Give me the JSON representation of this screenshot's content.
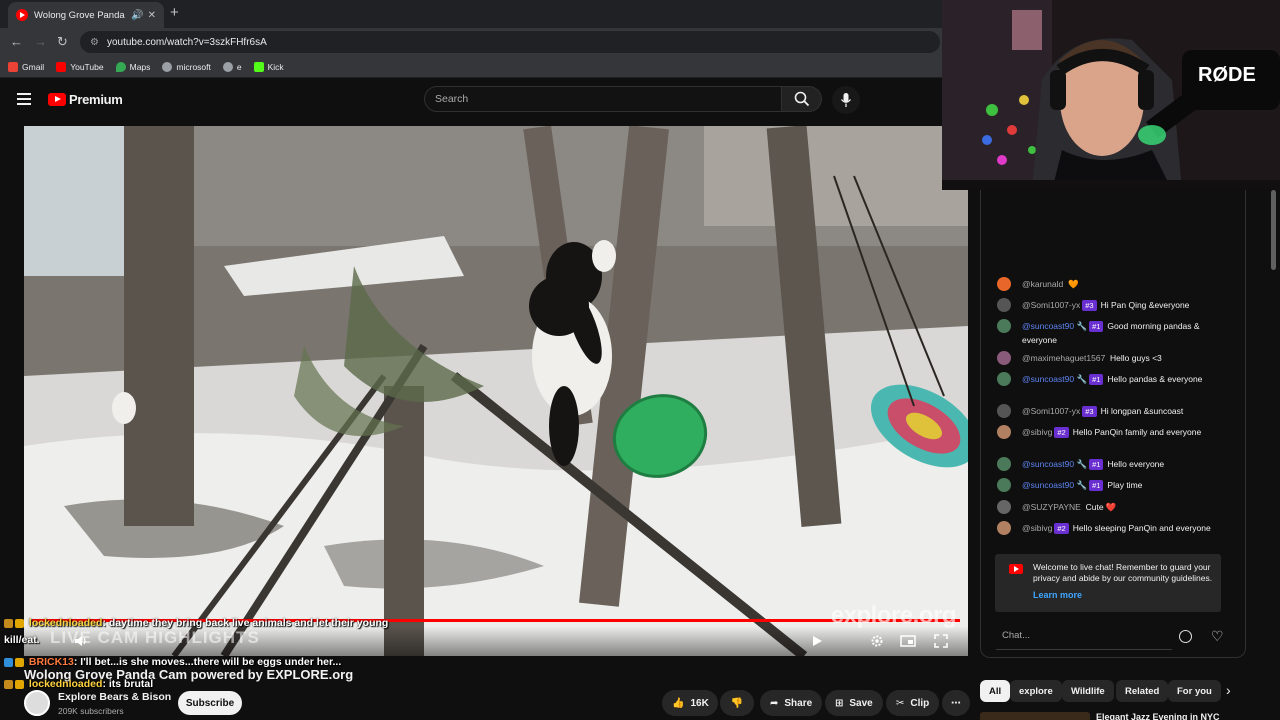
{
  "browser": {
    "tab_title": "Wolong Grove Panda Cam",
    "url": "youtube.com/watch?v=3szkFHfr6sA",
    "bookmarks": [
      "Gmail",
      "YouTube",
      "Maps",
      "microsoft",
      "e",
      "Kick"
    ]
  },
  "header": {
    "logo_text": "Premium",
    "search_placeholder": "Search"
  },
  "video": {
    "watermark": "explore.org",
    "overlay_lines": [
      {
        "user": "lockednloaded",
        "text": ": daytime they bring back live animals and let their young"
      },
      {
        "user": "",
        "text": "kill/eat."
      },
      {
        "user": "BRICK13",
        "text": ": I'll bet...is she moves...there will be eggs under her..."
      },
      {
        "user": "lockednloaded",
        "text": ": its brutal"
      }
    ],
    "overlay_highlights": "LIVE CAM HIGHLIGHTS",
    "title": "Wolong Grove Panda Cam powered by EXPLORE.org"
  },
  "channel": {
    "name": "Explore Bears & Bison",
    "subscribers": "209K subscribers",
    "subscribe_label": "Subscribe"
  },
  "actions": {
    "likes": "16K",
    "share": "Share",
    "save": "Save",
    "clip": "Clip"
  },
  "webcam": {
    "mic_brand": "RØDE"
  },
  "chat": {
    "messages": [
      {
        "author": "@karunald",
        "badge": "",
        "text": "🧡",
        "mod": false,
        "color": "#e8662a"
      },
      {
        "author": "@Somi1007-yx",
        "badge": "#3",
        "text": "Hi Pan Qing &everyone",
        "mod": false,
        "color": "#555"
      },
      {
        "author": "@suncoast90",
        "badge": "#1",
        "text": "Good morning pandas & everyone",
        "mod": true,
        "color": "#4a7a5a"
      },
      {
        "author": "@maximehaguet1567",
        "badge": "",
        "text": "Hello guys <3",
        "mod": false,
        "color": "#8a5a7a"
      },
      {
        "author": "@suncoast90",
        "badge": "#1",
        "text": "Hello pandas & everyone",
        "mod": true,
        "color": "#4a7a5a"
      },
      {
        "author": "@Somi1007-yx",
        "badge": "#3",
        "text": "Hi longpan &suncoast",
        "mod": false,
        "color": "#555"
      },
      {
        "author": "@sibivg",
        "badge": "#2",
        "text": "Hello PanQin family and everyone",
        "mod": false,
        "color": "#b08060"
      },
      {
        "author": "@suncoast90",
        "badge": "#1",
        "text": "Hello everyone",
        "mod": true,
        "color": "#4a7a5a"
      },
      {
        "author": "@suncoast90",
        "badge": "#1",
        "text": "Play time",
        "mod": true,
        "color": "#4a7a5a"
      },
      {
        "author": "@SUZYPAYNE",
        "badge": "",
        "text": "Cute ❤️",
        "mod": false,
        "color": "#666"
      },
      {
        "author": "@sibivg",
        "badge": "#2",
        "text": "Hello sleeping PanQin and everyone",
        "mod": false,
        "color": "#b08060"
      }
    ],
    "welcome": "Welcome to live chat! Remember to guard your privacy and abide by our community guidelines.",
    "learn_more": "Learn more",
    "input_placeholder": "Chat..."
  },
  "chips": [
    "All",
    "explore",
    "Wildlife",
    "Related",
    "For you"
  ],
  "recommendation": {
    "title": "Elegant Jazz Evening in NYC"
  },
  "colors": {
    "accent": "#ff0000",
    "link": "#3ea6ff",
    "mod_name": "#5e84f1",
    "member_badge": "#6a2fd0"
  }
}
